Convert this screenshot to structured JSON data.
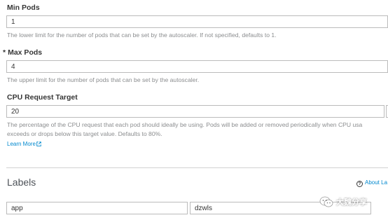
{
  "min_pods": {
    "label": "Min Pods",
    "value": "1",
    "help": "The lower limit for the number of pods that can be set by the autoscaler. If not specified, defaults to 1."
  },
  "max_pods": {
    "required_marker": "*",
    "label": "Max Pods",
    "value": "4",
    "help": "The upper limit for the number of pods that can be set by the autoscaler."
  },
  "cpu_target": {
    "label": "CPU Request Target",
    "value": "20",
    "help_line1": "The percentage of the CPU request that each pod should ideally be using. Pods will be added or removed periodically when CPU usa",
    "help_line2": "exceeds or drops below this target value. Defaults to 80%.",
    "learn_more": "Learn More"
  },
  "labels": {
    "title": "Labels",
    "about_link": "About La",
    "rows": [
      {
        "key": "app",
        "value": "dzwls"
      }
    ]
  },
  "watermark": {
    "text": "大魏分享"
  },
  "colors": {
    "link": "#0088ce",
    "help_text": "#8b8d8f",
    "border": "#bbbbbb"
  }
}
